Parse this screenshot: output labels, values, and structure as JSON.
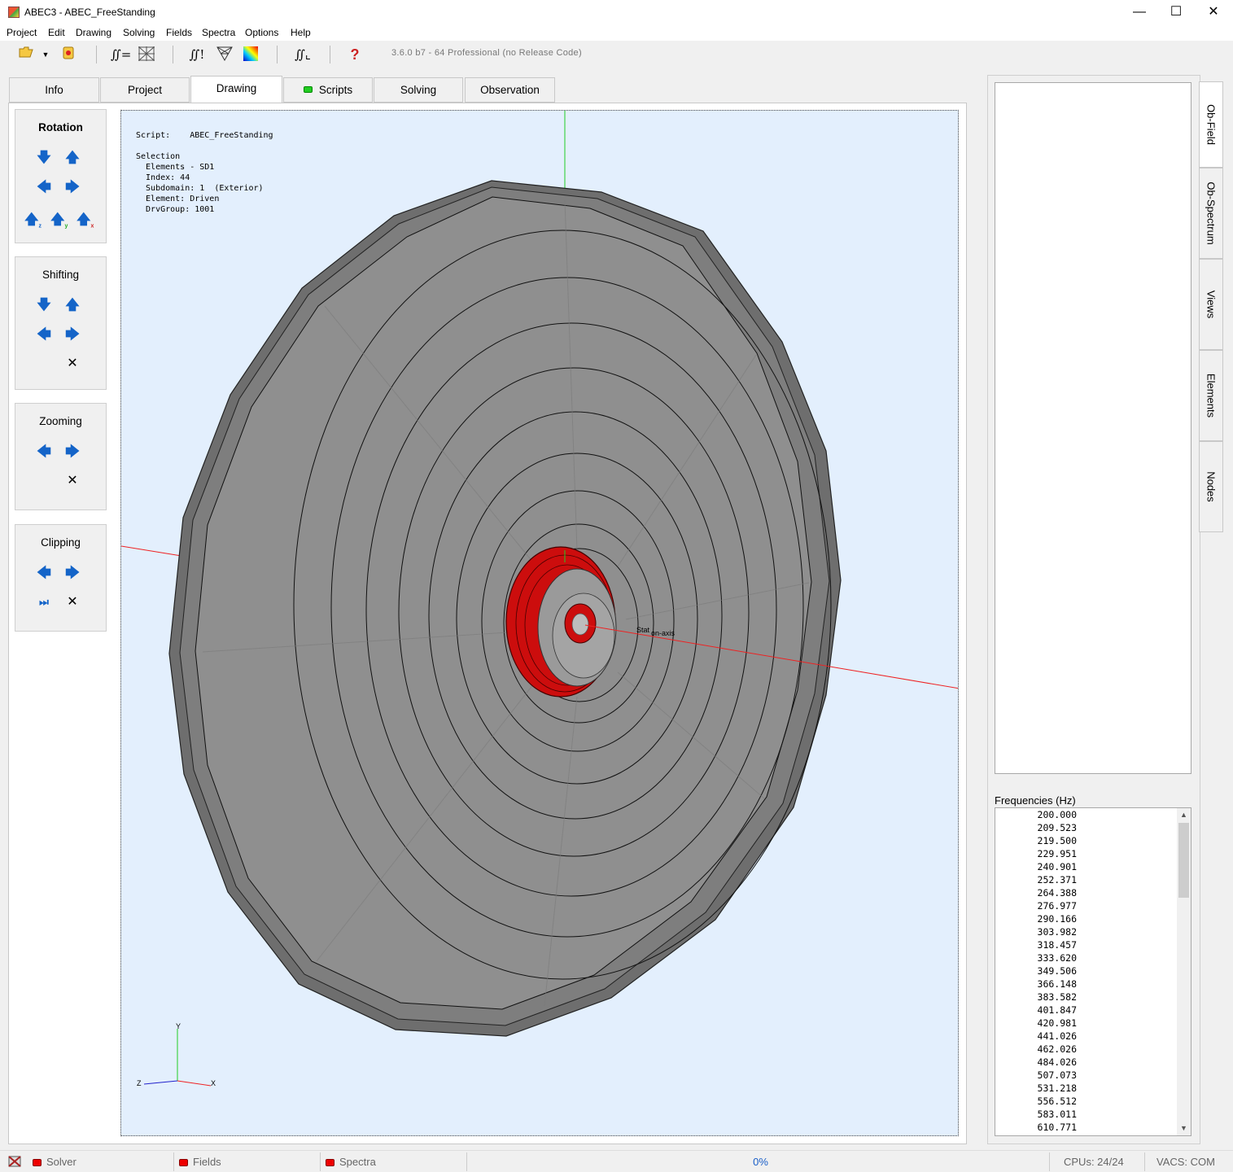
{
  "window": {
    "title": "ABEC3 - ABEC_FreeStanding",
    "minimize": "—",
    "maximize": "☐",
    "close": "✕"
  },
  "menu": [
    "Project",
    "Edit",
    "Drawing",
    "Solving",
    "Fields",
    "Spectra",
    "Options",
    "Help"
  ],
  "toolbar": {
    "version": "3.6.0 b7 - 64 Professional (no Release Code)",
    "icons": [
      "folder-open-icon",
      "dropdown-icon",
      "record-icon",
      "integral-equals-icon",
      "mesh-icon",
      "integral-excl-icon",
      "mesh-triangles-icon",
      "color-map-icon",
      "integral-curve-icon",
      "help-icon"
    ]
  },
  "tabs": [
    "Info",
    "Project",
    "Drawing",
    "Scripts",
    "Solving",
    "Observation"
  ],
  "active_tab": "Drawing",
  "controls": {
    "rotation": "Rotation",
    "shifting": "Shifting",
    "zooming": "Zooming",
    "clipping": "Clipping"
  },
  "viewport": {
    "info_text": "Script:    ABEC_FreeStanding\n\nSelection\n  Elements - SD1\n  Index: 44\n  Subdomain: 1  (Exterior)\n  Element: Driven\n  DrvGroup: 1001",
    "station_label": "Stat",
    "axis_label": "on-axis",
    "axis_x": "X",
    "axis_y": "Y",
    "axis_z": "Z"
  },
  "right_tabs": [
    "Ob-Field",
    "Ob-Spectrum",
    "Views",
    "Elements",
    "Nodes"
  ],
  "frequencies": {
    "label": "Frequencies  (Hz)",
    "values": [
      "200.000",
      "209.523",
      "219.500",
      "229.951",
      "240.901",
      "252.371",
      "264.388",
      "276.977",
      "290.166",
      "303.982",
      "318.457",
      "333.620",
      "349.506",
      "366.148",
      "383.582",
      "401.847",
      "420.981",
      "441.026",
      "462.026",
      "484.026",
      "507.073",
      "531.218",
      "556.512",
      "583.011",
      "610.771"
    ]
  },
  "status": {
    "solver": "Solver",
    "fields": "Fields",
    "spectra": "Spectra",
    "progress": "0%",
    "cpus": "CPUs: 24/24",
    "vacs": "VACS: COM"
  }
}
